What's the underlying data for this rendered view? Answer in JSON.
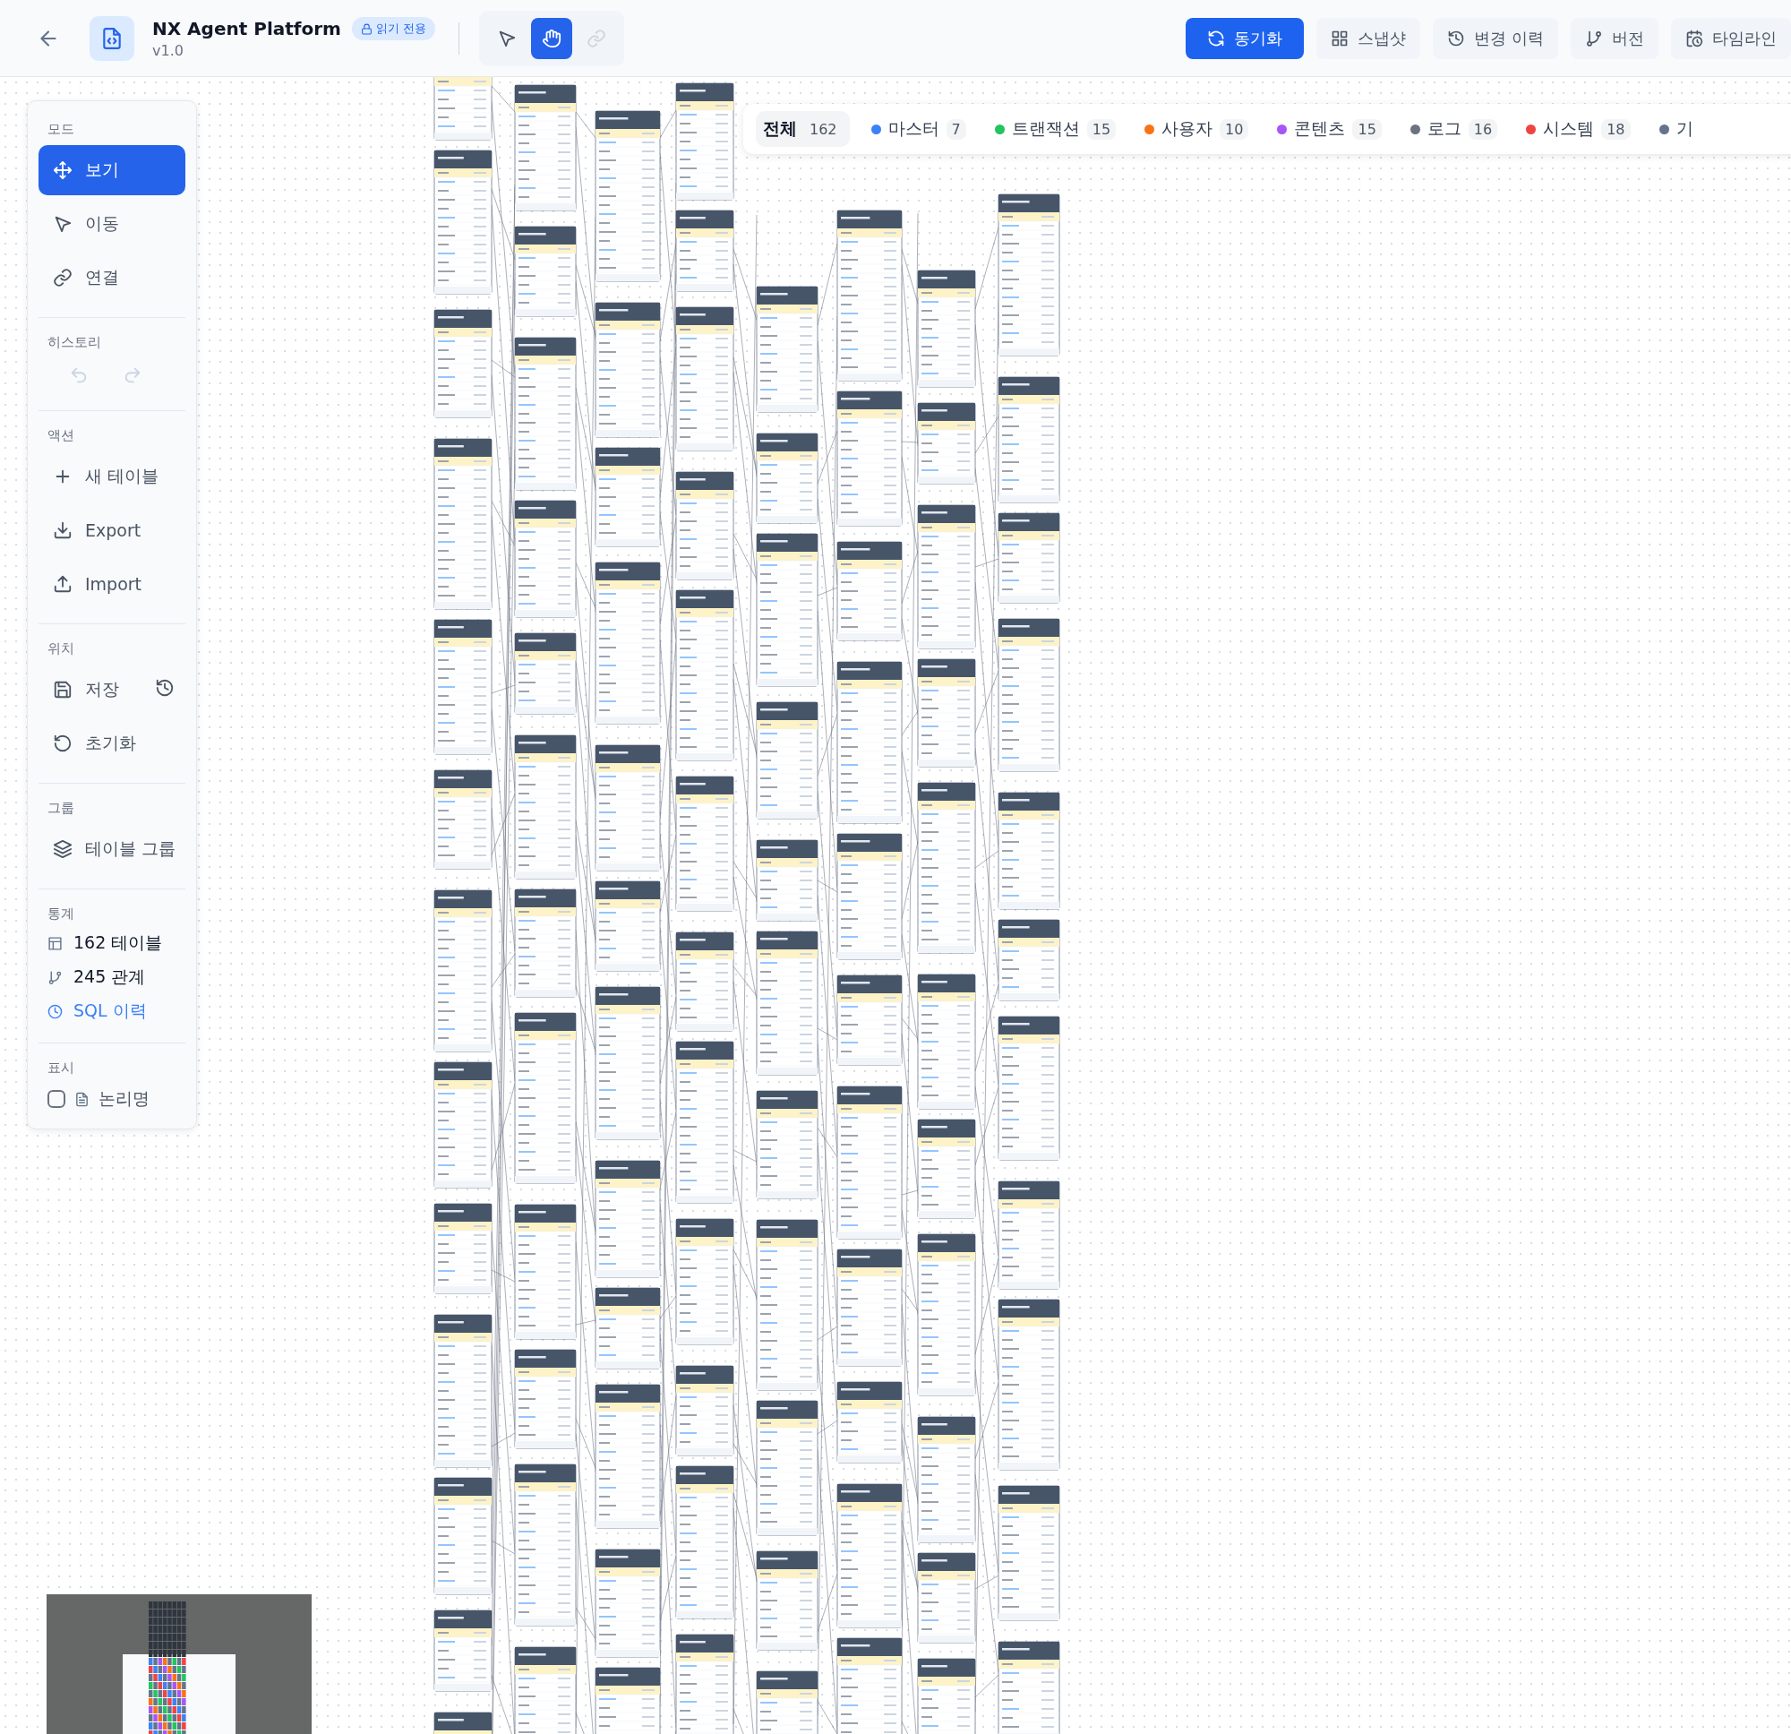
{
  "header": {
    "title": "NX Agent Platform",
    "version": "v1.0",
    "badge": "읽기 전용",
    "tools": [
      {
        "kind": "select",
        "selected": false,
        "disabled": false
      },
      {
        "kind": "pan",
        "selected": true,
        "disabled": false
      },
      {
        "kind": "connect",
        "selected": false,
        "disabled": true
      }
    ],
    "actions": [
      {
        "kind": "sync",
        "label": "동기화",
        "primary": true
      },
      {
        "kind": "snapshot",
        "label": "스냅샷",
        "primary": false
      },
      {
        "kind": "history",
        "label": "변경 이력",
        "primary": false
      },
      {
        "kind": "version",
        "label": "버전",
        "primary": false
      },
      {
        "kind": "timeline",
        "label": "타임라인",
        "primary": false
      }
    ]
  },
  "filters": [
    {
      "label": "전체",
      "count": "162",
      "selected": true
    },
    {
      "label": "마스터",
      "count": "7",
      "color": "#3b82f6",
      "selected": false
    },
    {
      "label": "트랜잭션",
      "count": "15",
      "color": "#22c55e",
      "selected": false
    },
    {
      "label": "사용자",
      "count": "10",
      "color": "#f97316",
      "selected": false
    },
    {
      "label": "콘텐츠",
      "count": "15",
      "color": "#a855f7",
      "selected": false
    },
    {
      "label": "로그",
      "count": "16",
      "color": "#6b7280",
      "selected": false
    },
    {
      "label": "시스템",
      "count": "18",
      "color": "#ef4444",
      "selected": false
    },
    {
      "label": "기",
      "color": "#64748b",
      "selected": false
    }
  ],
  "sidebar": {
    "sections": [
      {
        "title": "모드",
        "kind": "list",
        "items": [
          {
            "kind": "view",
            "label": "보기",
            "selected": true
          },
          {
            "kind": "move",
            "label": "이동",
            "selected": false
          },
          {
            "kind": "connect",
            "label": "연결",
            "selected": false
          }
        ]
      },
      {
        "title": "히스토리",
        "kind": "icons",
        "items": [
          {
            "kind": "undo",
            "disabled": true
          },
          {
            "kind": "redo",
            "disabled": true
          }
        ]
      },
      {
        "title": "액션",
        "kind": "list",
        "items": [
          {
            "kind": "add",
            "label": "새 테이블"
          },
          {
            "kind": "export",
            "label": "Export"
          },
          {
            "kind": "import",
            "label": "Import"
          }
        ]
      },
      {
        "title": "위치",
        "kind": "list",
        "items": [
          {
            "kind": "save",
            "label": "저장"
          },
          {
            "kind": "reset",
            "label": "초기화"
          }
        ]
      },
      {
        "title": "그룹",
        "kind": "list",
        "items": [
          {
            "kind": "group",
            "label": "테이블 그룹"
          }
        ]
      },
      {
        "title": "통계",
        "kind": "stats",
        "items": [
          {
            "kind": "tables",
            "label": "162 테이블"
          },
          {
            "kind": "relations",
            "label": "245 관계"
          },
          {
            "kind": "sql",
            "label": "SQL 이력"
          }
        ]
      },
      {
        "title": "표시",
        "kind": "checks",
        "items": [
          {
            "kind": "logical",
            "label": "논리명",
            "checked": false
          }
        ]
      }
    ]
  }
}
